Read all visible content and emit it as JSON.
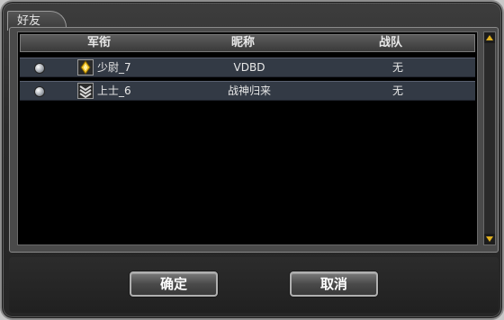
{
  "dialog": {
    "tab_label": "好友"
  },
  "table": {
    "columns": [
      "军衔",
      "昵称",
      "战队"
    ],
    "rows": [
      {
        "rank": "少尉_7",
        "nickname": "VDBD",
        "team": "无",
        "rank_icon": "gold-diamond-icon"
      },
      {
        "rank": "上士_6",
        "nickname": "战神归来",
        "team": "无",
        "rank_icon": "chevron-stripes-icon"
      }
    ]
  },
  "buttons": {
    "confirm": "确定",
    "cancel": "取消"
  },
  "colors": {
    "row_bg": "#333a45",
    "list_bg": "#000000",
    "scroll_arrow": "#e0b020"
  }
}
